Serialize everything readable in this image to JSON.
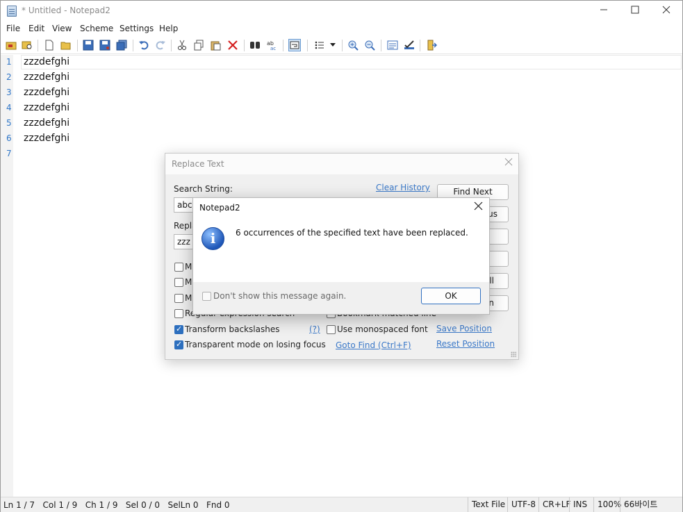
{
  "window": {
    "title": "* Untitled - Notepad2",
    "minimize_icon": "minimize-icon",
    "maximize_icon": "maximize-icon",
    "close_icon": "close-icon"
  },
  "menu": [
    "File",
    "Edit",
    "View",
    "Scheme",
    "Settings",
    "Help"
  ],
  "toolbar_icons": [
    "browse-icon",
    "find-file-icon",
    "new-icon",
    "open-icon",
    "save-icon",
    "save-as-icon",
    "save-copy-icon",
    "undo-icon",
    "redo-icon",
    "cut-icon",
    "copy-icon",
    "paste-icon",
    "delete-icon",
    "find-icon",
    "replace-icon",
    "word-wrap-icon",
    "list-icon",
    "dropdown-icon",
    "zoom-in-icon",
    "zoom-out-icon",
    "scheme-icon",
    "customize-icon",
    "exit-icon"
  ],
  "editor": {
    "line_numbers": [
      "1",
      "2",
      "3",
      "4",
      "5",
      "6",
      "7"
    ],
    "lines": [
      "zzzdefghi",
      "zzzdefghi",
      "zzzdefghi",
      "zzzdefghi",
      "zzzdefghi",
      "zzzdefghi",
      ""
    ]
  },
  "replace_dialog": {
    "title": "Replace Text",
    "search_label": "Search String:",
    "search_value": "abc",
    "replace_label": "Repla",
    "replace_value": "zzz",
    "clear_history": "Clear History",
    "find_next": "Find Next",
    "find_prev_fragment": "us",
    "replace_all_fragment": "ll",
    "replace_sel_fragment": "n",
    "opt_m1": "M",
    "opt_m2": "M",
    "opt_m3": "M",
    "opt_regex": "Regular expression search",
    "opt_transform": "Transform backslashes",
    "opt_transparent": "Transparent mode on losing focus",
    "help_link": "(?)",
    "opt_bookmark": "Bookmark matched line",
    "opt_monospaced": "Use monospaced font",
    "save_position": "Save Position",
    "reset_position": "Reset Position",
    "goto_find": "Goto Find (Ctrl+F)",
    "transform_checked": true,
    "transparent_checked": true
  },
  "message_box": {
    "title": "Notepad2",
    "message": "6 occurrences of the specified text have been replaced.",
    "dont_show": "Don't show this message again.",
    "ok": "OK",
    "icon": "info-icon"
  },
  "status": {
    "left": "Ln 1 / 7   Col 1 / 9   Ch 1 / 9   Sel 0 / 0   SelLn 0   Fnd 0",
    "file_type": "Text File",
    "encoding": "UTF-8",
    "line_ending": "CR+LF",
    "mode": "INS",
    "zoom": "100%",
    "size": "66바이트"
  }
}
